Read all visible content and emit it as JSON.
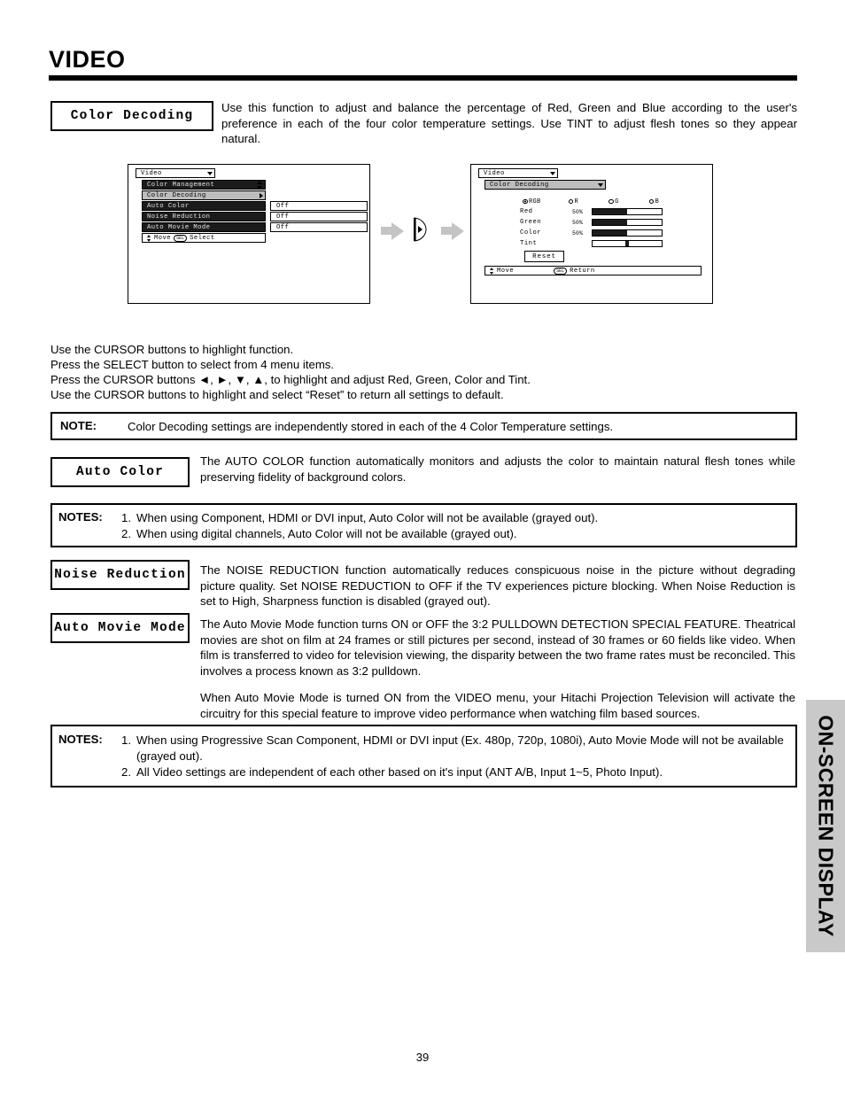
{
  "page": {
    "title": "VIDEO",
    "number": "39",
    "side_tab": "ON-SCREEN DISPLAY"
  },
  "sections": {
    "color_decoding": {
      "tag": "Color Decoding",
      "body": "Use this function to adjust and balance the percentage of Red, Green and Blue according to the user's preference in each of the four color temperature settings.  Use TINT to adjust flesh tones so they appear natural."
    },
    "auto_color": {
      "tag": "Auto Color",
      "body": "The AUTO COLOR function automatically monitors and adjusts the color to maintain natural flesh tones while preserving fidelity of background colors."
    },
    "noise_reduction": {
      "tag": "Noise Reduction",
      "body": "The NOISE REDUCTION function automatically reduces conspicuous noise in the picture without degrading picture quality.  Set NOISE REDUCTION to OFF if the TV experiences picture blocking.  When Noise Reduction is set to High, Sharpness function is disabled (grayed out)."
    },
    "auto_movie_mode": {
      "tag": "Auto Movie Mode",
      "body1": "The Auto Movie Mode function turns ON or OFF the 3:2 PULLDOWN DETECTION SPECIAL FEATURE.  Theatrical movies are shot on film at 24 frames or still pictures per second, instead of 30 frames or 60 fields like video.  When film is transferred to video for television viewing, the disparity between the two frame rates must be reconciled.  This involves a process known as 3:2 pulldown.",
      "body2": "When Auto Movie Mode is turned ON from the VIDEO menu, your Hitachi Projection Television will activate the circuitry for this special feature to improve video performance when watching film based sources."
    }
  },
  "instructions": {
    "line1": "Use the CURSOR buttons to highlight function.",
    "line2": "Press the SELECT button to select from 4 menu items.",
    "line3": "Press the CURSOR buttons ◄, ►, ▼, ▲, to highlight and adjust Red, Green, Color and Tint.",
    "line4": "Use the CURSOR buttons to highlight and select “Reset” to return all settings to default."
  },
  "notes": {
    "note1": {
      "label": "NOTE:",
      "text": "Color Decoding settings are independently stored in each of the 4 Color Temperature settings."
    },
    "note2": {
      "label": "NOTES:",
      "items": [
        {
          "num": "1.",
          "text": "When using Component, HDMI or DVI input, Auto Color will not be available (grayed out)."
        },
        {
          "num": "2.",
          "text": "When using digital channels, Auto Color will not be available (grayed out)."
        }
      ]
    },
    "note3": {
      "label": "NOTES:",
      "items": [
        {
          "num": "1.",
          "text": "When using Progressive Scan Component, HDMI or DVI input (Ex. 480p, 720p, 1080i), Auto Movie Mode will not be available (grayed out)."
        },
        {
          "num": "2.",
          "text": "All Video settings are independent of each other based on it's input (ANT A/B, Input 1~5, Photo Input)."
        }
      ]
    }
  },
  "osd_left": {
    "header": "Video",
    "rows": [
      {
        "label": "Color Management",
        "value": "",
        "state": "dark",
        "caret": "updown"
      },
      {
        "label": "Color Decoding",
        "value": "",
        "state": "highlight",
        "caret": "right"
      },
      {
        "label": "Auto Color",
        "value": "Off",
        "state": "dark",
        "caret": "none"
      },
      {
        "label": "Noise Reduction",
        "value": "Off",
        "state": "dark",
        "caret": "none"
      },
      {
        "label": "Auto Movie Mode",
        "value": "Off",
        "state": "dark",
        "caret": "none"
      }
    ],
    "footer_move": "Move",
    "footer_sel": "SEL",
    "footer_action": "Select"
  },
  "osd_right": {
    "header": "Video",
    "submenu": "Color Decoding",
    "radios": [
      {
        "label": "RGB",
        "selected": true
      },
      {
        "label": "R",
        "selected": false
      },
      {
        "label": "G",
        "selected": false
      },
      {
        "label": "B",
        "selected": false
      }
    ],
    "sliders": [
      {
        "label": "Red",
        "percent": "50%",
        "fill": 50
      },
      {
        "label": "Green",
        "percent": "50%",
        "fill": 50
      },
      {
        "label": "Color",
        "percent": "50%",
        "fill": 50
      },
      {
        "label": "Tint",
        "percent": "",
        "fill": -1
      }
    ],
    "reset": "Reset",
    "footer_move": "Move",
    "footer_sel": "SEL",
    "footer_action": "Return"
  }
}
